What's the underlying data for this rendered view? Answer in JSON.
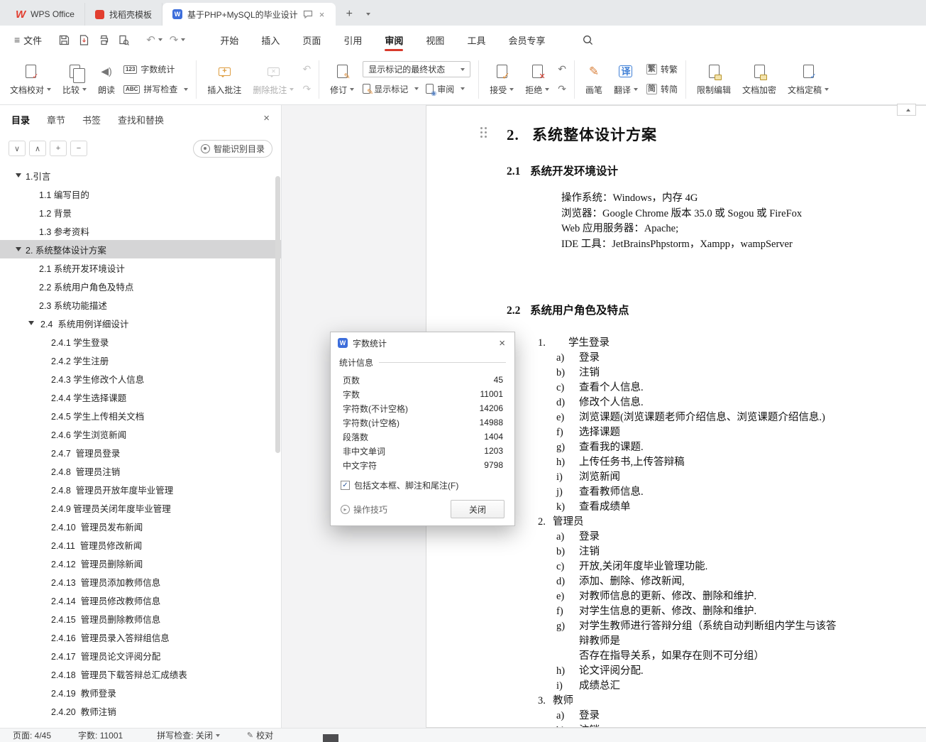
{
  "tabbar": {
    "home_tab": "WPS Office",
    "docer_tab": "找稻壳模板",
    "doc_tab": "基于PHP+MySQL的毕业设计",
    "new_tab": "+"
  },
  "menubar": {
    "file": "文件",
    "items": [
      {
        "t": "开始"
      },
      {
        "t": "插入"
      },
      {
        "t": "页面"
      },
      {
        "t": "引用"
      },
      {
        "t": "审阅",
        "active": true
      },
      {
        "t": "视图"
      },
      {
        "t": "工具"
      },
      {
        "t": "会员专享"
      }
    ]
  },
  "ribbon": {
    "proof": "文档校对",
    "compare": "比较",
    "read": "朗读",
    "word_count": "字数统计",
    "spell": "拼写检查",
    "insert_comment": "插入批注",
    "delete_comment": "删除批注",
    "track": "修订",
    "markup_state": "显示标记的最终状态",
    "show_markup": "显示标记",
    "review": "审阅",
    "accept": "接受",
    "reject": "拒绝",
    "pen": "画笔",
    "translate": "翻译",
    "to_trad": "转繁",
    "to_simp": "转简",
    "restrict": "限制编辑",
    "encrypt": "文档加密",
    "finalize": "文档定稿",
    "icons": {
      "word_count": "123",
      "spell": "ABC",
      "translate": "译",
      "to_trad": "繁",
      "to_simp": "简",
      "read": "◀)",
      "prev": "↶",
      "next": "↷",
      "undo": "↶",
      "redo": "↷"
    }
  },
  "sidebar": {
    "tabs": [
      {
        "t": "目录",
        "active": true
      },
      {
        "t": "章节"
      },
      {
        "t": "书签"
      },
      {
        "t": "查找和替换"
      }
    ],
    "tools": {
      "collapse": "∨",
      "expand": "∧",
      "plus": "+",
      "minus": "−"
    },
    "smart_toc": "智能识别目录",
    "toc": [
      {
        "level": 1,
        "arrow": true,
        "t": "1.引言"
      },
      {
        "level": 2,
        "t": "1.1 编写目的"
      },
      {
        "level": 2,
        "t": "1.2 背景"
      },
      {
        "level": 2,
        "t": "1.3 参考资料"
      },
      {
        "level": 1,
        "arrow": true,
        "selected": true,
        "t": "2. 系统整体设计方案"
      },
      {
        "level": 2,
        "t": "2.1 系统开发环境设计"
      },
      {
        "level": 2,
        "t": "2.2 系统用户角色及特点"
      },
      {
        "level": 2,
        "t": "2.3 系统功能描述"
      },
      {
        "level": 2,
        "arrow": true,
        "t": "2.4  系统用例详细设计"
      },
      {
        "level": 3,
        "t": "2.4.1 学生登录"
      },
      {
        "level": 3,
        "t": "2.4.2 学生注册"
      },
      {
        "level": 3,
        "t": "2.4.3 学生修改个人信息"
      },
      {
        "level": 3,
        "t": "2.4.4 学生选择课题"
      },
      {
        "level": 3,
        "t": "2.4.5 学生上传相关文档"
      },
      {
        "level": 3,
        "t": "2.4.6 学生浏览新闻"
      },
      {
        "level": 3,
        "t": "2.4.7  管理员登录"
      },
      {
        "level": 3,
        "t": "2.4.8  管理员注销"
      },
      {
        "level": 3,
        "t": "2.4.8  管理员开放年度毕业管理"
      },
      {
        "level": 3,
        "t": "2.4.9 管理员关闭年度毕业管理"
      },
      {
        "level": 3,
        "t": "2.4.10  管理员发布新闻"
      },
      {
        "level": 3,
        "t": "2.4.11  管理员修改新闻"
      },
      {
        "level": 3,
        "t": "2.4.12  管理员删除新闻"
      },
      {
        "level": 3,
        "t": "2.4.13  管理员添加教师信息"
      },
      {
        "level": 3,
        "t": "2.4.14  管理员修改教师信息"
      },
      {
        "level": 3,
        "t": "2.4.15  管理员删除教师信息"
      },
      {
        "level": 3,
        "t": "2.4.16  管理员录入答辩组信息"
      },
      {
        "level": 3,
        "t": "2.4.17  管理员论文评阅分配"
      },
      {
        "level": 3,
        "t": "2.4.18  管理员下载答辩总汇成绩表"
      },
      {
        "level": 3,
        "t": "2.4.19  教师登录"
      },
      {
        "level": 3,
        "t": "2.4.20  教师注销"
      }
    ]
  },
  "document": {
    "lines": [
      {
        "c": "title",
        "m": "2.",
        "t": "系统整体设计方案"
      },
      {
        "c": "h2 first",
        "m": "2.1",
        "t": "系统开发环境设计"
      },
      {
        "c": "body",
        "t": "操作系统：Windows，内存 4G"
      },
      {
        "c": "body",
        "t": "浏览器：Google Chrome 版本 35.0 或 Sogou 或 FireFox"
      },
      {
        "c": "body",
        "t": "Web 应用服务器：Apache;"
      },
      {
        "c": "body",
        "t": "IDE 工具：JetBrainsPhpstorm，Xampp，wampServer"
      },
      {
        "c": "h2 gapbig",
        "m": "2.2",
        "t": "系统用户角色及特点"
      },
      {
        "c": "num wide",
        "m": "1.",
        "t": "学生登录"
      },
      {
        "c": "sub",
        "m": "a)",
        "t": "登录"
      },
      {
        "c": "sub",
        "m": "b)",
        "t": "注销"
      },
      {
        "c": "sub",
        "m": "c)",
        "t": "查看个人信息."
      },
      {
        "c": "sub",
        "m": "d)",
        "t": "修改个人信息."
      },
      {
        "c": "sub",
        "m": "e)",
        "t": "浏览课题(浏览课题老师介绍信息、浏览课题介绍信息.)"
      },
      {
        "c": "sub",
        "m": "f)",
        "t": "选择课题"
      },
      {
        "c": "sub",
        "m": "g)",
        "t": "查看我的课题."
      },
      {
        "c": "sub",
        "m": "h)",
        "t": "上传任务书,上传答辩稿"
      },
      {
        "c": "sub",
        "m": "i)",
        "t": "浏览新闻"
      },
      {
        "c": "sub",
        "m": "j)",
        "t": "查看教师信息."
      },
      {
        "c": "sub",
        "m": "k)",
        "t": "查看成绩单"
      },
      {
        "c": "num",
        "m": "2.",
        "t": "管理员"
      },
      {
        "c": "sub",
        "m": "a)",
        "t": "登录"
      },
      {
        "c": "sub",
        "m": "b)",
        "t": "注销"
      },
      {
        "c": "sub",
        "m": "c)",
        "t": "开放,关闭年度毕业管理功能."
      },
      {
        "c": "sub",
        "m": "d)",
        "t": "添加、删除、修改新闻,"
      },
      {
        "c": "sub",
        "m": "e)",
        "t": "对教师信息的更新、修改、删除和维护."
      },
      {
        "c": "sub",
        "m": "f)",
        "t": "对学生信息的更新、修改、删除和维护."
      },
      {
        "c": "sub",
        "m": "g)",
        "t": "对学生教师进行答辩分组（系统自动判断组内学生与该答辩教师是"
      },
      {
        "c": "subcont",
        "t": "否存在指导关系，如果存在则不可分组）"
      },
      {
        "c": "sub",
        "m": "h)",
        "t": "论文评阅分配."
      },
      {
        "c": "sub",
        "m": "i)",
        "t": "成绩总汇"
      },
      {
        "c": "num",
        "m": "3.",
        "t": "教师"
      },
      {
        "c": "sub",
        "m": "a)",
        "t": "登录"
      },
      {
        "c": "sub",
        "m": "b)",
        "t": "注销"
      }
    ]
  },
  "dialog": {
    "title": "字数统计",
    "group": "统计信息",
    "stats": [
      {
        "label": "页数",
        "value": "45"
      },
      {
        "label": "字数",
        "value": "11001"
      },
      {
        "label": "字符数(不计空格)",
        "value": "14206"
      },
      {
        "label": "字符数(计空格)",
        "value": "14988"
      },
      {
        "label": "段落数",
        "value": "1404"
      },
      {
        "label": "非中文单词",
        "value": "1203"
      },
      {
        "label": "中文字符",
        "value": "9798"
      }
    ],
    "checkbox": "包括文本框、脚注和尾注(F)",
    "tips": "操作技巧",
    "close": "关闭"
  },
  "statusbar": {
    "page": "页面: 4/45",
    "words": "字数: 11001",
    "spell": "拼写检查: 关闭",
    "proof": "校对"
  }
}
